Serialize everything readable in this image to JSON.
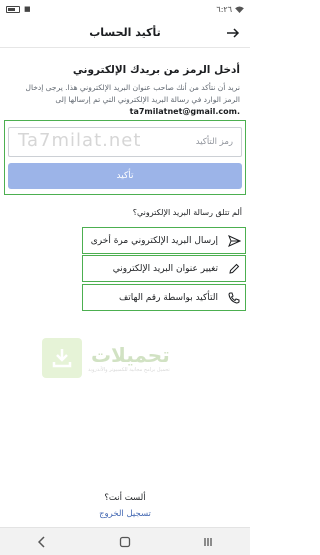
{
  "status_bar": {
    "time": "٦:٢٦"
  },
  "header": {
    "title": "تأكيد الحساب"
  },
  "main": {
    "heading": "أدخل الرمز من بريدك الإلكتروني",
    "description": "نريد أن نتأكد من أنك صاحب عنوان البريد الإلكتروني هذا. يرجى إدخال الرمز الوارد في رسالة البريد الإلكتروني التي تم إرسالها إلى",
    "email": "ta7milatnet@gmail.com.",
    "code_placeholder": "رمز التأكيد",
    "confirm_label": "تأكيد",
    "watermark": "Ta7milat.net"
  },
  "help": {
    "no_email": "ألم تتلق رسالة البريد الإلكتروني؟",
    "options": [
      {
        "label": "إرسال البريد الإلكتروني مرة أخرى",
        "icon": "send-icon"
      },
      {
        "label": "تغيير عنوان البريد الإلكتروني",
        "icon": "pencil-icon"
      },
      {
        "label": "التأكيد بواسطة رقم الهاتف",
        "icon": "phone-icon"
      }
    ]
  },
  "logo_watermark": {
    "title": "تحميلات",
    "subtitle": "تحميل برامج مجانية للكمبيوتر والأندرويد"
  },
  "footer": {
    "question": "ألست أنت؟",
    "logout": "تسجيل الخروج"
  },
  "colors": {
    "accent": "#4267b2",
    "button_disabled": "#9cb4e8",
    "highlight": "#4caf50"
  }
}
